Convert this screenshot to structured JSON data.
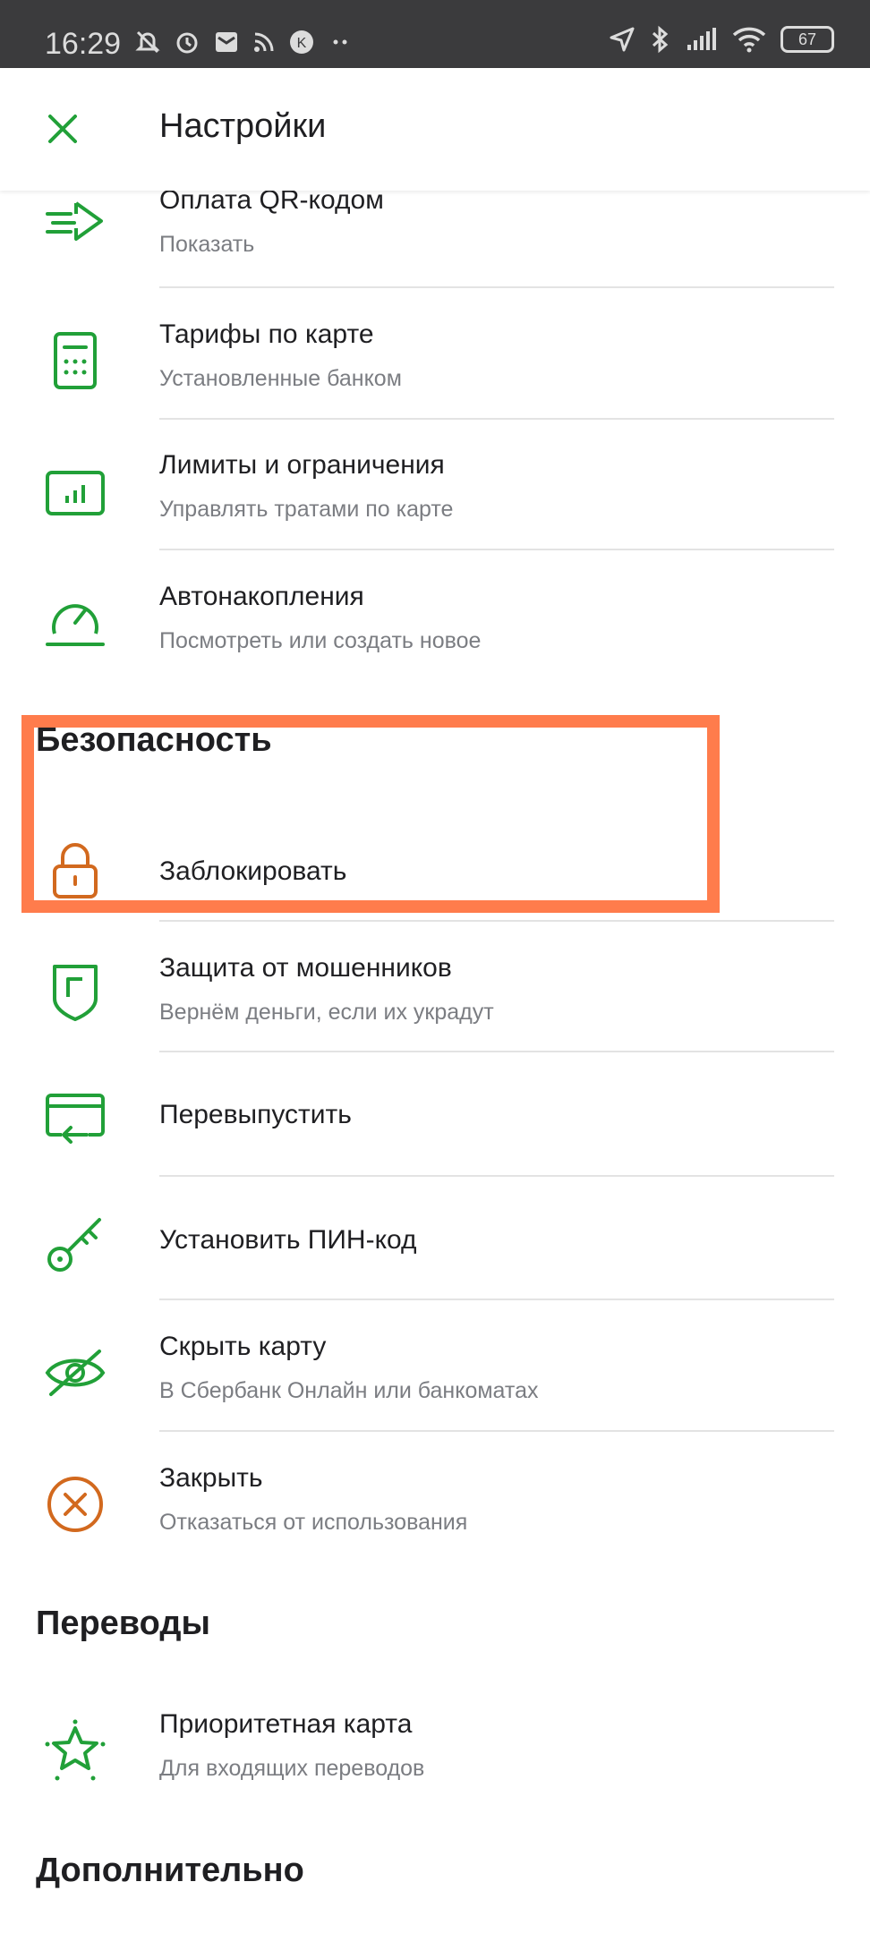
{
  "status_bar": {
    "time": "16:29",
    "battery": "67"
  },
  "header": {
    "title": "Настройки"
  },
  "sections": {
    "security": "Безопасность",
    "transfers": "Переводы",
    "extra": "Дополнительно"
  },
  "items": {
    "qr_pay": {
      "title": "Оплата QR-кодом",
      "subtitle": "Показать"
    },
    "tariffs": {
      "title": "Тарифы по карте",
      "subtitle": "Установленные банком"
    },
    "limits": {
      "title": "Лимиты и ограничения",
      "subtitle": "Управлять тратами по карте"
    },
    "autosave": {
      "title": "Автонакопления",
      "subtitle": "Посмотреть или создать новое"
    },
    "block": {
      "title": "Заблокировать"
    },
    "fraud": {
      "title": "Защита от мошенников",
      "subtitle": "Вернём деньги, если их украдут"
    },
    "reissue": {
      "title": "Перевыпустить"
    },
    "pin": {
      "title": "Установить ПИН-код"
    },
    "hide": {
      "title": "Скрыть карту",
      "subtitle": "В Сбербанк Онлайн или банкоматах"
    },
    "close": {
      "title": "Закрыть",
      "subtitle": "Отказаться от использования"
    },
    "priority": {
      "title": "Приоритетная карта",
      "subtitle": "Для входящих переводов"
    }
  },
  "colors": {
    "green": "#21a038",
    "orange": "#d2691e",
    "highlight": "#ff7c4c"
  }
}
